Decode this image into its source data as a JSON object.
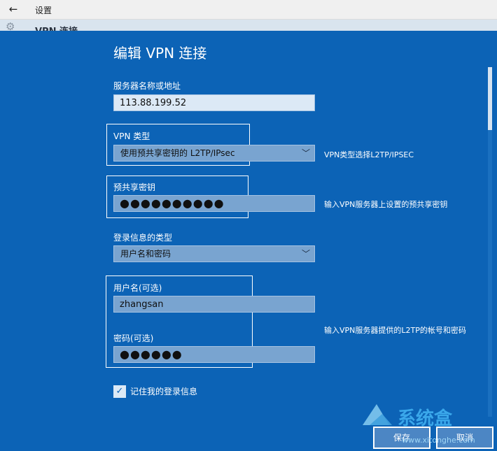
{
  "window": {
    "title": "设置"
  },
  "background_page": {
    "title": "VPN 连接"
  },
  "dialog": {
    "title": "编辑 VPN 连接",
    "server": {
      "label": "服务器名称或地址",
      "value": "113.88.199.52"
    },
    "vpn_type": {
      "label": "VPN 类型",
      "value": "使用预共享密钥的 L2TP/IPsec",
      "note": "VPN类型选择L2TP/IPSEC"
    },
    "psk": {
      "label": "预共享密钥",
      "masked": "●●●●●●●●●●",
      "note": "输入VPN服务器上设置的预共享密钥"
    },
    "login_type": {
      "label": "登录信息的类型",
      "value": "用户名和密码"
    },
    "username": {
      "label": "用户名(可选)",
      "value": "zhangsan"
    },
    "password": {
      "label": "密码(可选)",
      "masked": "●●●●●●"
    },
    "cred_note": "输入VPN服务器提供的L2TP的帐号和密码",
    "remember": {
      "label": "记住我的登录信息",
      "checked": true
    },
    "save_label": "保存",
    "cancel_label": "取消"
  },
  "watermark": {
    "name": "系统盒",
    "url": "www.xitonghe.com"
  },
  "colors": {
    "dialog_bg": "#0c63b6",
    "field_bg": "#79a4d0",
    "highlight": "#ffffff"
  },
  "icons": {
    "back": "arrow-left-icon",
    "chevron": "chevron-down-icon",
    "check": "checkmark-icon",
    "settings": "gear-icon"
  }
}
